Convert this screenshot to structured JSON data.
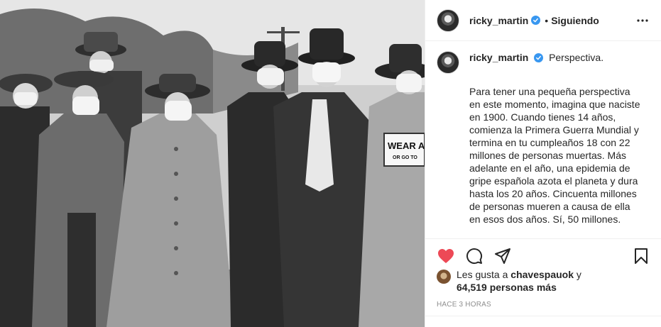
{
  "post": {
    "image_alt": "",
    "sign_text_line1": "WEAR A M",
    "sign_text_line2": "OR GO TO"
  },
  "header": {
    "username": "ricky_martin",
    "separator": "•",
    "follow_status": "Siguiendo",
    "verified": true
  },
  "caption": {
    "username": "ricky_martin",
    "lead": "Perspectiva.",
    "body": "Para tener una pequeña perspectiva en este momento, imagina que naciste en 1900. Cuando tienes 14 años, comienza la Primera Guerra Mundial y termina en tu cumpleaños 18 con 22 millones de personas muertas. Más adelante en el año, una epidemia de gripe española azota el planeta y dura hasta los 20 años. Cincuenta millones de personas mueren a causa de ella en esos dos años. Sí, 50 millones."
  },
  "actions": {
    "like_icon": "heart-filled-icon",
    "comment_icon": "comment-icon",
    "share_icon": "paper-plane-icon",
    "save_icon": "bookmark-icon",
    "like_color": "#ed4956"
  },
  "likes": {
    "prefix": "Les gusta a",
    "liker": "chavespauok",
    "connector": "y",
    "count_text": "64,519 personas más"
  },
  "timestamp": "HACE 3 HORAS",
  "colors": {
    "verified": "#3897f0",
    "border": "#efefef",
    "muted": "#8e8e8e"
  }
}
